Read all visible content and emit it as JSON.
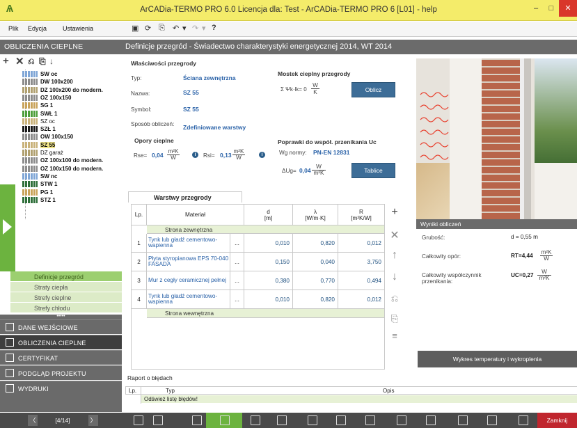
{
  "window": {
    "title": "ArCADia-TERMO PRO 6.0 Licencja dla: Test - ArCADia-TERMO PRO 6 [L01] - help",
    "min": "–",
    "max": "□",
    "close": "✕"
  },
  "menu": {
    "items": [
      "Plik",
      "Edycja",
      "Ustawienia"
    ],
    "help": "?"
  },
  "left": {
    "header": "OBLICZENIA CIEPLNE",
    "tree": [
      {
        "label": "SW oc",
        "bold": true,
        "icon": "wall-icon",
        "color": "#7fa6d6"
      },
      {
        "label": "DW 100x200",
        "bold": true,
        "icon": "door-icon",
        "color": "#8c8c8c"
      },
      {
        "label": "DZ 100x200 do modern.",
        "bold": true,
        "icon": "door-icon",
        "color": "#b0a070"
      },
      {
        "label": "OZ 100x150",
        "bold": true,
        "icon": "window-icon",
        "color": "#8c8c8c"
      },
      {
        "label": "SG 1",
        "bold": true,
        "icon": "floor-icon",
        "color": "#c9a35a"
      },
      {
        "label": "SWŁ 1",
        "bold": true,
        "icon": "wall-icon",
        "color": "#4d9e3b"
      },
      {
        "label": "SZ oc",
        "bold": false,
        "icon": "wall-icon",
        "color": "#c9b27a"
      },
      {
        "label": "SZŁ 1",
        "bold": true,
        "icon": "wall-icon",
        "color": "#1a1a1a"
      },
      {
        "label": "OW 100x150",
        "bold": true,
        "icon": "window-icon",
        "color": "#8c8c8c"
      },
      {
        "label": "SZ 55",
        "bold": true,
        "icon": "wall-icon",
        "color": "#c9b27a",
        "selected": true
      },
      {
        "label": "DZ garaż",
        "bold": false,
        "icon": "door-icon",
        "color": "#b0a070"
      },
      {
        "label": "OZ 100x100 do modern.",
        "bold": true,
        "icon": "window-icon",
        "color": "#8c8c8c"
      },
      {
        "label": "OZ 100x150 do modern.",
        "bold": true,
        "icon": "window-icon",
        "color": "#8c8c8c"
      },
      {
        "label": "SW nc",
        "bold": true,
        "icon": "wall-icon",
        "color": "#7fa6d6"
      },
      {
        "label": "STW 1",
        "bold": true,
        "icon": "ceiling-icon",
        "color": "#2f6f3a"
      },
      {
        "label": "PG 1",
        "bold": true,
        "icon": "floor-icon",
        "color": "#c9a35a"
      },
      {
        "label": "STZ 1",
        "bold": true,
        "icon": "ceiling-icon",
        "color": "#2f6f3a"
      }
    ],
    "submenu": [
      {
        "label": "Definicje przegród",
        "active": true
      },
      {
        "label": "Straty ciepła",
        "active": false
      },
      {
        "label": "Strefy cieplne",
        "active": false
      },
      {
        "label": "Strefy chłodu",
        "active": false
      }
    ],
    "dots": "•••••",
    "nav": [
      {
        "label": "DANE WEJŚCIOWE",
        "active": false
      },
      {
        "label": "OBLICZENIA CIEPLNE",
        "active": true
      },
      {
        "label": "CERTYFIKAT",
        "active": false
      },
      {
        "label": "PODGLĄD PROJEKTU",
        "active": false
      },
      {
        "label": "WYDRUKI",
        "active": false
      }
    ]
  },
  "main": {
    "header": "Definicje przegród - Świadectwo charakterystyki energetycznej 2014, WT 2014",
    "props": {
      "title": "Właściwości przegrody",
      "typ_label": "Typ:",
      "typ_value": "Ściana zewnętrzna",
      "nazwa_label": "Nazwa:",
      "nazwa_value": "SZ 55",
      "symbol_label": "Symbol:",
      "symbol_value": "SZ 55",
      "sposob_label": "Sposób obliczeń:",
      "sposob_value": "Zdefiniowane warstwy"
    },
    "mostek": {
      "title": "Mostek cieplny przegrody",
      "formula": "Σ Ψk·lk= 0",
      "unit_num": "W",
      "unit_den": "K",
      "button": "Oblicz"
    },
    "opory": {
      "title": "Opory cieplne",
      "rse_label": "Rse=",
      "rse": "0,04",
      "rsi_label": "Rsi=",
      "rsi": "0,13",
      "unit_num": "m²K",
      "unit_den": "W"
    },
    "poprawki": {
      "title": "Poprawki do współ. przenikania Uc",
      "norm_label": "Wg normy:",
      "norm_value": "PN-EN 12831",
      "du_label": "ΔUg=",
      "du": "0,04",
      "unit_num": "W",
      "unit_den": "m²K",
      "button": "Tablice"
    },
    "layers": {
      "tab": "Warstwy przegrody",
      "headers": {
        "lp": "Lp.",
        "mat": "Materiał",
        "d": "d",
        "d_unit": "[m]",
        "lambda": "λ",
        "lambda_unit": "[W/m·K]",
        "r": "R",
        "r_unit": "[m²K/W]"
      },
      "outer": "Strona zewnętrzna",
      "inner": "Strona wewnętrzna",
      "rows": [
        {
          "lp": "1",
          "material": "Tynk lub gładź cementowo-wapienna",
          "d": "0,010",
          "lambda": "0,820",
          "r": "0,012"
        },
        {
          "lp": "2",
          "material": "Płyta styropianowa EPS 70-040 FASADA",
          "d": "0,150",
          "lambda": "0,040",
          "r": "3,750"
        },
        {
          "lp": "3",
          "material": "Mur z cegły ceramicznej pełnej",
          "d": "0,380",
          "lambda": "0,770",
          "r": "0,494"
        },
        {
          "lp": "4",
          "material": "Tynk lub gładź cementowo-wapienna",
          "d": "0,010",
          "lambda": "0,820",
          "r": "0,012"
        }
      ],
      "more": "..."
    },
    "results": {
      "title": "Wyniki obliczeń",
      "grubosc_label": "Grubość:",
      "grubosc": "d = 0,55 m",
      "opor_label": "Całkowity opór:",
      "opor": "RT=4,44",
      "opor_unit_num": "m²K",
      "opor_unit_den": "W",
      "wsp_label": "Całkowity współczynnik przenikania:",
      "wsp": "UC=0,27",
      "wsp_unit_num": "W",
      "wsp_unit_den": "m²K",
      "wykres_button": "Wykres temperatury i wykroplenia"
    },
    "raport": {
      "title": "Raport o błędach",
      "col_lp": "Lp.",
      "col_typ": "Typ",
      "col_opis": "Opis",
      "refresh": "Odśwież listę błędów!"
    }
  },
  "bottom": {
    "page": "[4/14]",
    "prev": "〈",
    "next": "〉",
    "close": "Zamknij"
  }
}
